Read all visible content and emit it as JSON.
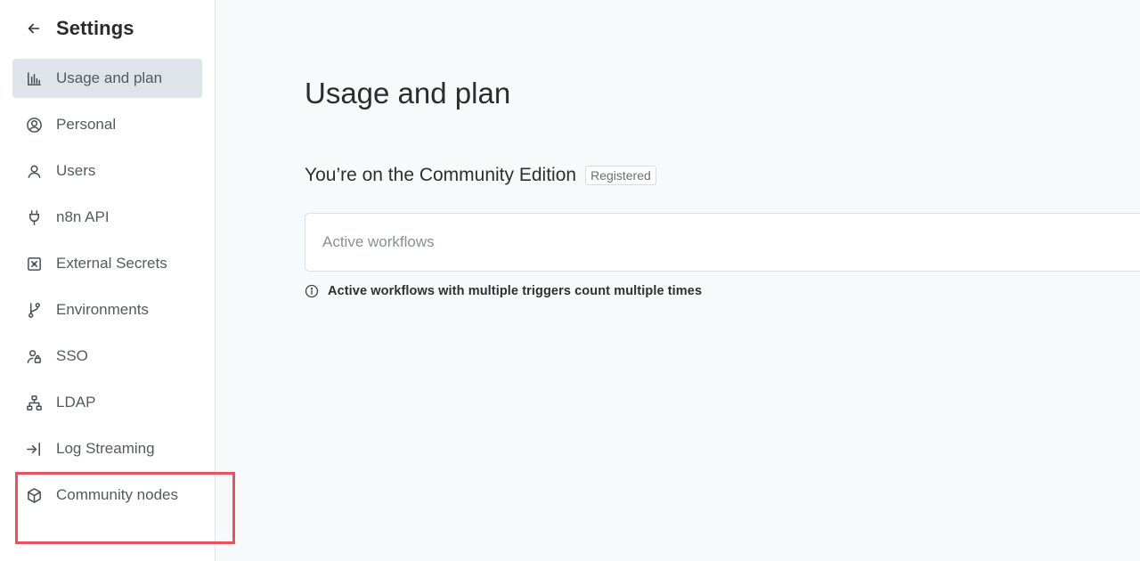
{
  "sidebar": {
    "title": "Settings",
    "back_icon": "arrow-left-icon",
    "items": [
      {
        "label": "Usage and plan",
        "icon": "bar-chart-icon",
        "active": true
      },
      {
        "label": "Personal",
        "icon": "user-circle-icon"
      },
      {
        "label": "Users",
        "icon": "user-icon"
      },
      {
        "label": "n8n API",
        "icon": "plug-icon"
      },
      {
        "label": "External Secrets",
        "icon": "vault-icon"
      },
      {
        "label": "Environments",
        "icon": "git-branch-icon"
      },
      {
        "label": "SSO",
        "icon": "user-lock-icon"
      },
      {
        "label": "LDAP",
        "icon": "network-icon"
      },
      {
        "label": "Log Streaming",
        "icon": "sign-in-icon"
      },
      {
        "label": "Community nodes",
        "icon": "cube-icon"
      }
    ]
  },
  "main": {
    "page_title": "Usage and plan",
    "edition_text": "You’re on the Community Edition",
    "edition_badge": "Registered",
    "card_label": "Active workflows",
    "note": "Active workflows with multiple triggers count multiple times"
  },
  "colors": {
    "highlight": "#e8525a",
    "active_bg": "#dfe3ea",
    "page_bg": "#f8f9fb"
  }
}
